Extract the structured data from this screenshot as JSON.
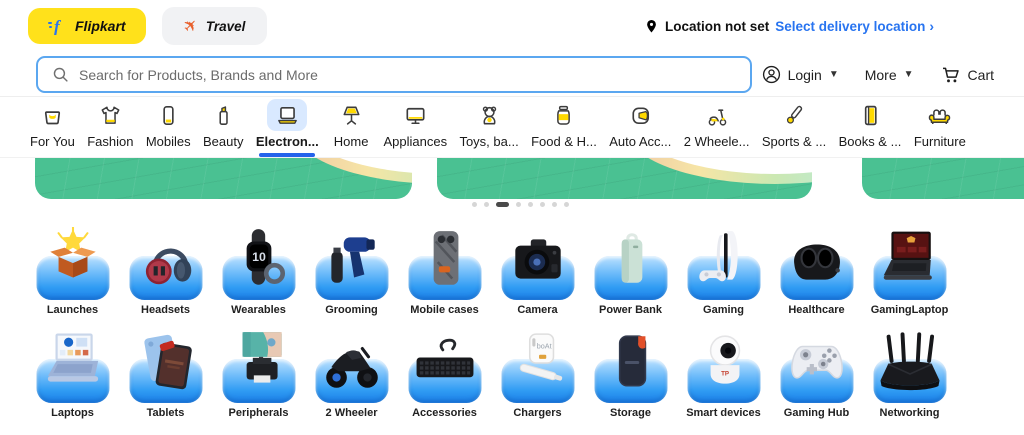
{
  "header": {
    "logo_label": "Flipkart",
    "travel_label": "Travel",
    "location_status": "Location not set",
    "location_link": "Select delivery location",
    "search_placeholder": "Search for Products, Brands and More",
    "login_label": "Login",
    "more_label": "More",
    "cart_label": "Cart",
    "icons": [
      "flipkart-f-icon",
      "plane-icon",
      "location-pin-icon",
      "search-icon",
      "user-icon",
      "chevron-down-icon",
      "cart-icon",
      "chevron-right-icon"
    ]
  },
  "nav": {
    "items": [
      {
        "label": "For You",
        "icon": "bag-icon",
        "active": false
      },
      {
        "label": "Fashion",
        "icon": "tshirt-icon",
        "active": false
      },
      {
        "label": "Mobiles",
        "icon": "phone-icon",
        "active": false
      },
      {
        "label": "Beauty",
        "icon": "lipstick-icon",
        "active": false
      },
      {
        "label": "Electron...",
        "icon": "laptop-icon",
        "active": true
      },
      {
        "label": "Home",
        "icon": "lamp-icon",
        "active": false
      },
      {
        "label": "Appliances",
        "icon": "tv-icon",
        "active": false
      },
      {
        "label": "Toys, ba...",
        "icon": "teddy-icon",
        "active": false
      },
      {
        "label": "Food & H...",
        "icon": "jar-icon",
        "active": false
      },
      {
        "label": "Auto Acc...",
        "icon": "helmet-icon",
        "active": false
      },
      {
        "label": "2 Wheele...",
        "icon": "scooter-icon",
        "active": false
      },
      {
        "label": "Sports & ...",
        "icon": "cricket-bat-icon",
        "active": false
      },
      {
        "label": "Books & ...",
        "icon": "book-icon",
        "active": false
      },
      {
        "label": "Furniture",
        "icon": "sofa-icon",
        "active": false
      }
    ]
  },
  "carousel": {
    "dot_count": 8,
    "active_dot_index": 2
  },
  "grid": {
    "items": [
      {
        "label": "Launches",
        "icon": "launch-box-image"
      },
      {
        "label": "Headsets",
        "icon": "headset-image"
      },
      {
        "label": "Wearables",
        "icon": "smartwatch-image"
      },
      {
        "label": "Grooming",
        "icon": "hairdryer-image"
      },
      {
        "label": "Mobile cases",
        "icon": "phone-case-image"
      },
      {
        "label": "Camera",
        "icon": "camera-image"
      },
      {
        "label": "Power Bank",
        "icon": "powerbank-image"
      },
      {
        "label": "Gaming",
        "icon": "console-image"
      },
      {
        "label": "Healthcare",
        "icon": "massager-image"
      },
      {
        "label": "GamingLaptop",
        "icon": "gaming-laptop-image"
      },
      {
        "label": "Laptops",
        "icon": "laptop-image"
      },
      {
        "label": "Tablets",
        "icon": "tablet-image"
      },
      {
        "label": "Peripherals",
        "icon": "monitor-printer-image"
      },
      {
        "label": "2 Wheeler",
        "icon": "motorcycle-image"
      },
      {
        "label": "Accessories",
        "icon": "keyboard-image"
      },
      {
        "label": "Chargers",
        "icon": "charger-image"
      },
      {
        "label": "Storage",
        "icon": "ssd-image"
      },
      {
        "label": "Smart devices",
        "icon": "security-camera-image"
      },
      {
        "label": "Gaming Hub",
        "icon": "controller-image"
      },
      {
        "label": "Networking",
        "icon": "router-image"
      }
    ]
  },
  "colors": {
    "brand_yellow": "#FFE11B",
    "link_blue": "#2874F0",
    "nav_active_underline": "#2563EB",
    "banner_green": "#4AC192",
    "tile_blue": "#2F9BF3"
  }
}
